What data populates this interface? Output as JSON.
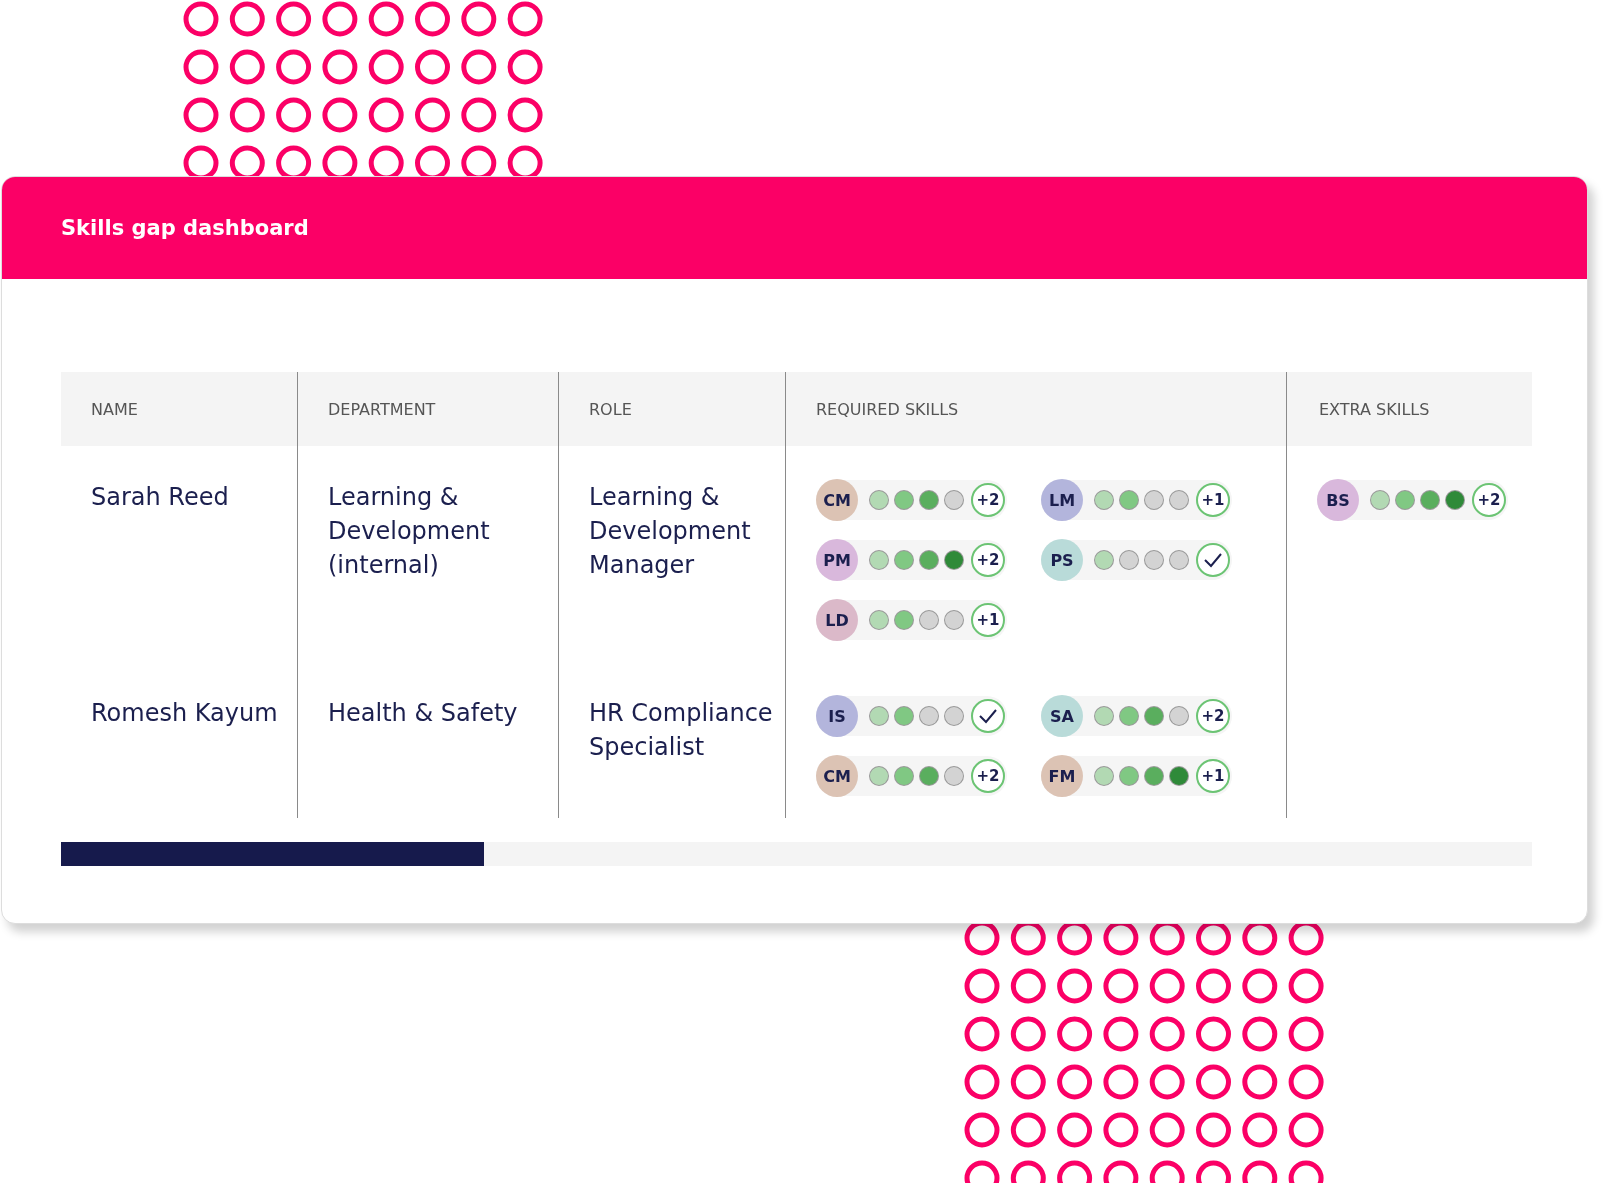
{
  "title": "Skills gap dashboard",
  "columns": [
    "NAME",
    "DEPARTMENT",
    "ROLE",
    "REQUIRED SKILLS",
    "EXTRA SKILLS"
  ],
  "rows": [
    {
      "name": "Sarah Reed",
      "department": "Learning & Development (internal)",
      "role": "Learning & Development Manager",
      "required_skills": [
        {
          "initials": "CM",
          "color": "#dcc3b4",
          "dots": [
            {
              "color": "#b2d9b3"
            },
            {
              "color": "#80c883"
            },
            {
              "color": "#5aae5e"
            },
            {
              "color": "#d3d3d3"
            }
          ],
          "badge": {
            "kind": "count",
            "label": "+2"
          }
        },
        {
          "initials": "LM",
          "color": "#b3b5dc",
          "dots": [
            {
              "color": "#b2d9b3"
            },
            {
              "color": "#80c883"
            },
            {
              "color": "#d3d3d3"
            },
            {
              "color": "#d3d3d3"
            }
          ],
          "badge": {
            "kind": "count",
            "label": "+1"
          }
        },
        {
          "initials": "PM",
          "color": "#d9b8dc",
          "dots": [
            {
              "color": "#b2d9b3"
            },
            {
              "color": "#80c883"
            },
            {
              "color": "#5aae5e"
            },
            {
              "color": "#2f8a39"
            }
          ],
          "badge": {
            "kind": "count",
            "label": "+2"
          }
        },
        {
          "initials": "PS",
          "color": "#b9dbd9",
          "dots": [
            {
              "color": "#b2d9b3"
            },
            {
              "color": "#d3d3d3"
            },
            {
              "color": "#d3d3d3"
            },
            {
              "color": "#d3d3d3"
            }
          ],
          "badge": {
            "kind": "check"
          }
        },
        {
          "initials": "LD",
          "color": "#dbb9c9",
          "dots": [
            {
              "color": "#b2d9b3"
            },
            {
              "color": "#80c883"
            },
            {
              "color": "#d3d3d3"
            },
            {
              "color": "#d3d3d3"
            }
          ],
          "badge": {
            "kind": "count",
            "label": "+1"
          }
        }
      ],
      "extra_skills": [
        {
          "initials": "BS",
          "color": "#d9b8dc",
          "dots": [
            {
              "color": "#b2d9b3"
            },
            {
              "color": "#80c883"
            },
            {
              "color": "#5aae5e"
            },
            {
              "color": "#2f8a39"
            }
          ],
          "badge": {
            "kind": "count",
            "label": "+2"
          }
        }
      ]
    },
    {
      "name": "Romesh Kayum",
      "department": "Health & Safety",
      "role": "HR Compliance Specialist",
      "required_skills": [
        {
          "initials": "IS",
          "color": "#b3b5dc",
          "dots": [
            {
              "color": "#b2d9b3"
            },
            {
              "color": "#80c883"
            },
            {
              "color": "#d3d3d3"
            },
            {
              "color": "#d3d3d3"
            }
          ],
          "badge": {
            "kind": "check"
          }
        },
        {
          "initials": "SA",
          "color": "#b9dbd9",
          "dots": [
            {
              "color": "#b2d9b3"
            },
            {
              "color": "#80c883"
            },
            {
              "color": "#5aae5e"
            },
            {
              "color": "#d3d3d3"
            }
          ],
          "badge": {
            "kind": "count",
            "label": "+2"
          }
        },
        {
          "initials": "CM",
          "color": "#dcc3b4",
          "dots": [
            {
              "color": "#b2d9b3"
            },
            {
              "color": "#80c883"
            },
            {
              "color": "#5aae5e"
            },
            {
              "color": "#d3d3d3"
            }
          ],
          "badge": {
            "kind": "count",
            "label": "+2"
          }
        },
        {
          "initials": "FM",
          "color": "#dcc3b4",
          "dots": [
            {
              "color": "#b2d9b3"
            },
            {
              "color": "#80c883"
            },
            {
              "color": "#5aae5e"
            },
            {
              "color": "#2f8a39"
            }
          ],
          "badge": {
            "kind": "count",
            "label": "+1"
          }
        }
      ],
      "extra_skills": []
    }
  ]
}
